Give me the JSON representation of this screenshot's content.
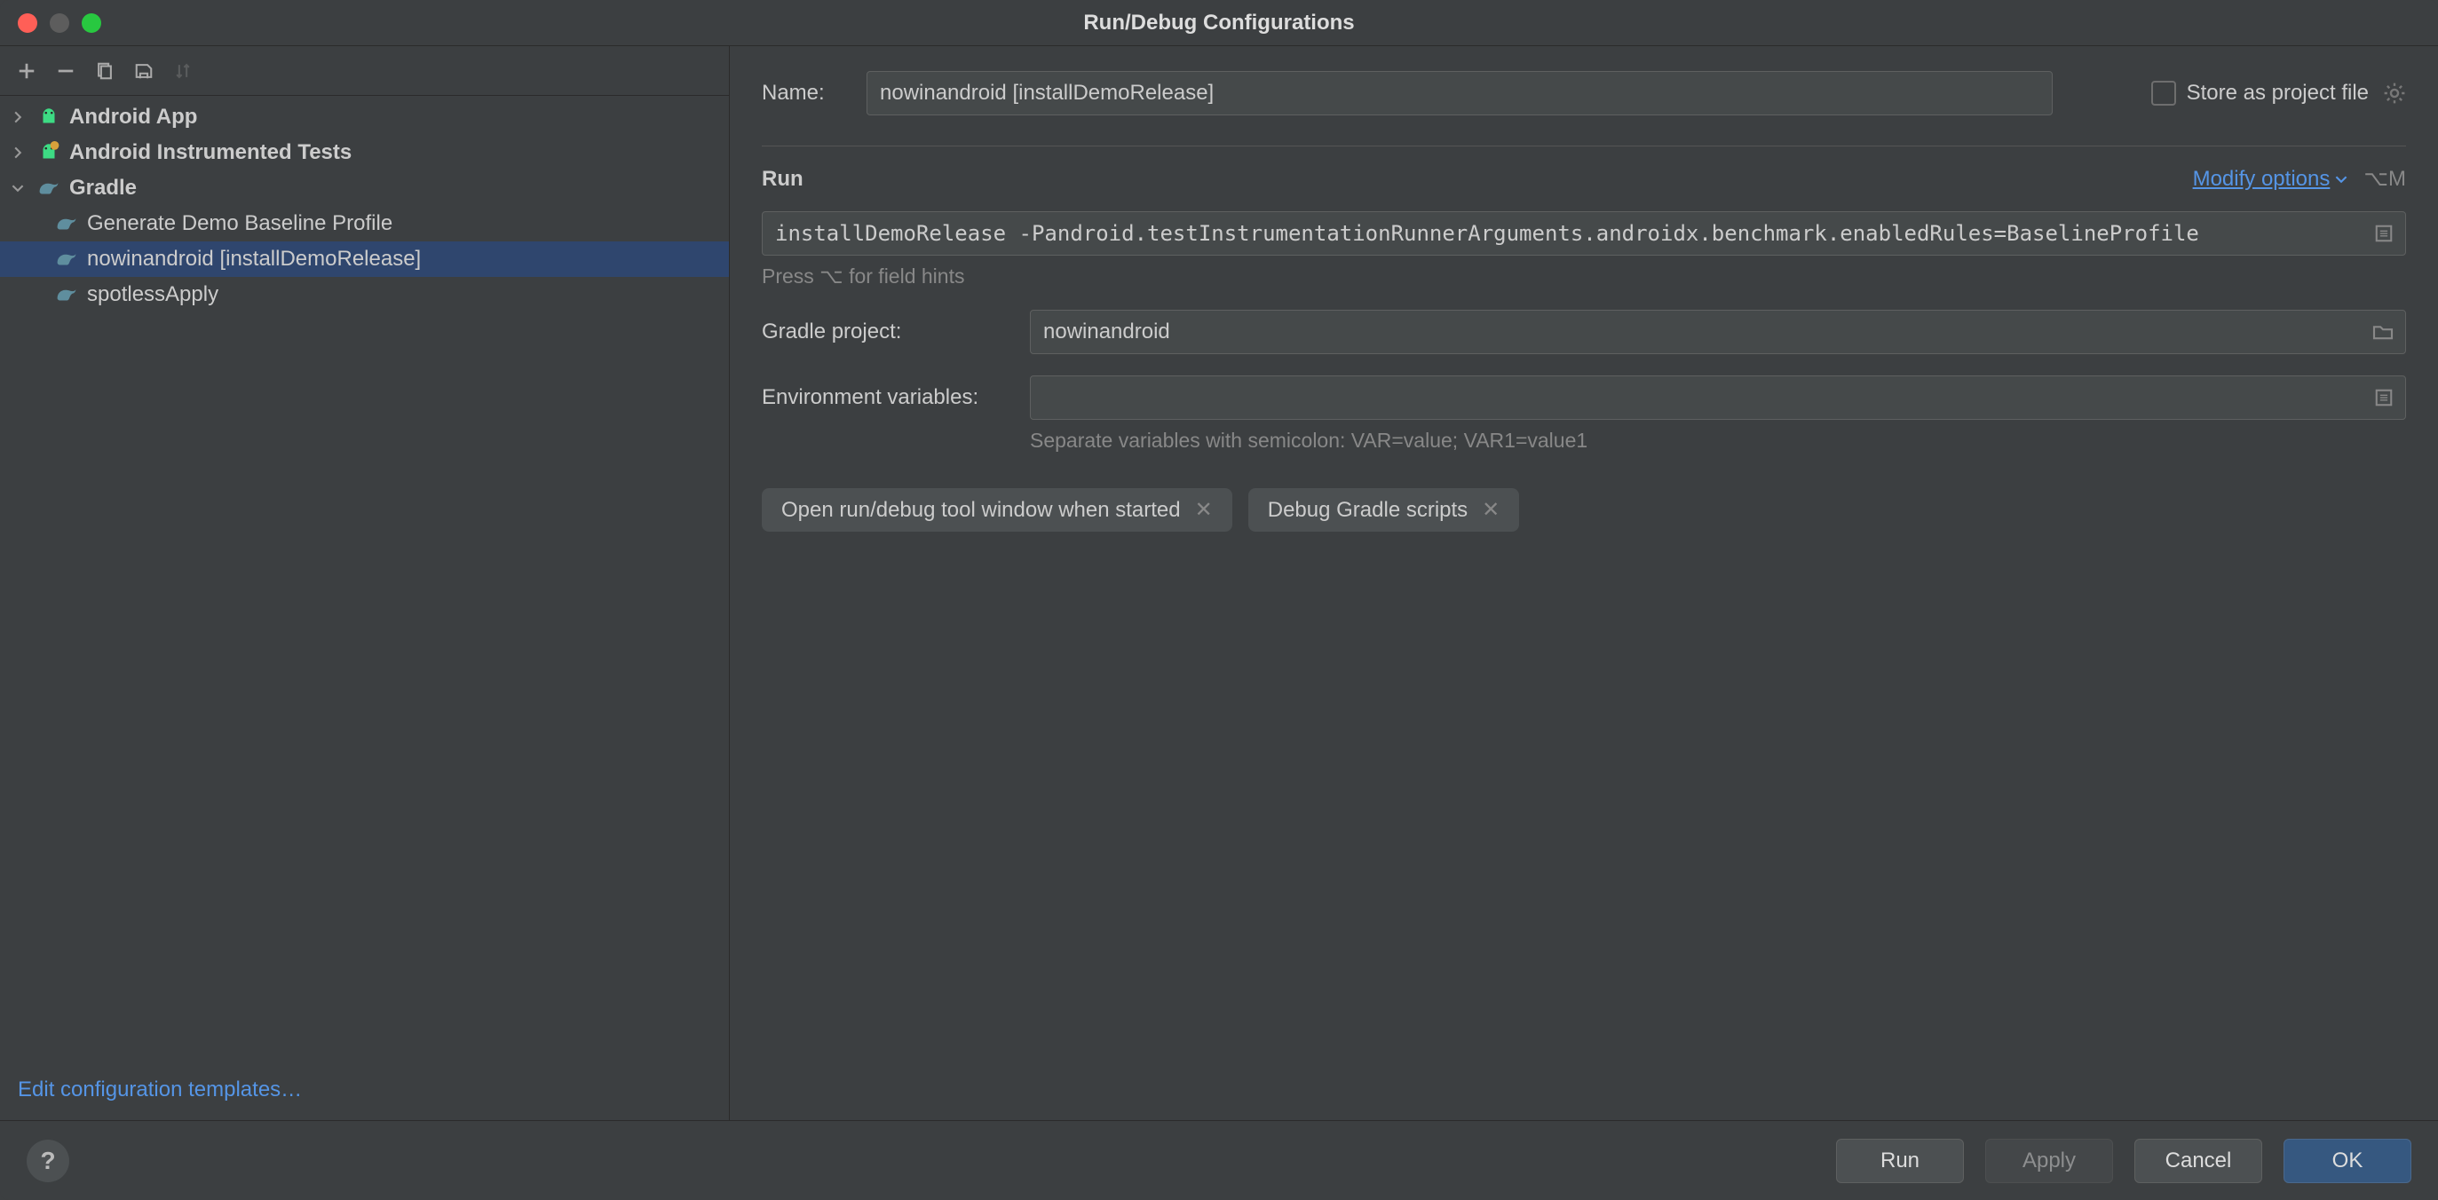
{
  "window": {
    "title": "Run/Debug Configurations"
  },
  "sidebar": {
    "edit_templates": "Edit configuration templates…",
    "tree": {
      "android_app": "Android App",
      "android_tests": "Android Instrumented Tests",
      "gradle": "Gradle",
      "gradle_items": {
        "generate_demo": "Generate Demo Baseline Profile",
        "install_demo": "nowinandroid [installDemoRelease]",
        "spotless": "spotlessApply"
      }
    }
  },
  "form": {
    "name_label": "Name:",
    "name_value": "nowinandroid [installDemoRelease]",
    "store_as_project_file": "Store as project file",
    "run_section": "Run",
    "modify_options": "Modify options",
    "modify_shortcut": "⌥M",
    "tasks_value": "installDemoRelease -Pandroid.testInstrumentationRunnerArguments.androidx.benchmark.enabledRules=BaselineProfile",
    "tasks_hint": "Press ⌥ for field hints",
    "gradle_project_label": "Gradle project:",
    "gradle_project_value": "nowinandroid",
    "env_vars_label": "Environment variables:",
    "env_vars_value": "",
    "env_vars_hint": "Separate variables with semicolon: VAR=value; VAR1=value1",
    "pills": {
      "open_tool_window": "Open run/debug tool window when started",
      "debug_gradle": "Debug Gradle scripts"
    }
  },
  "footer": {
    "run": "Run",
    "apply": "Apply",
    "cancel": "Cancel",
    "ok": "OK"
  }
}
